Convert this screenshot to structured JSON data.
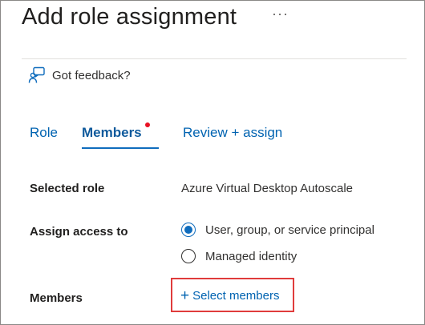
{
  "header": {
    "title": "Add role assignment",
    "more_label": "···"
  },
  "feedback": {
    "label": "Got feedback?",
    "icon": "feedback-person-icon"
  },
  "tabs": [
    {
      "label": "Role",
      "active": false
    },
    {
      "label": "Members",
      "active": true,
      "badge": "red-dot"
    },
    {
      "label": "Review + assign",
      "active": false
    }
  ],
  "form": {
    "selected_role_label": "Selected role",
    "selected_role_value": "Azure Virtual Desktop Autoscale",
    "assign_access_label": "Assign access to",
    "assign_options": [
      {
        "label": "User, group, or service principal",
        "selected": true
      },
      {
        "label": "Managed identity",
        "selected": false
      }
    ],
    "members_label": "Members",
    "select_members_plus": "+",
    "select_members_label": "Select members"
  },
  "colors": {
    "accent": "#0f6cbd",
    "link": "#0063b1",
    "highlight_box": "#e03c3c",
    "badge": "#e81123"
  }
}
